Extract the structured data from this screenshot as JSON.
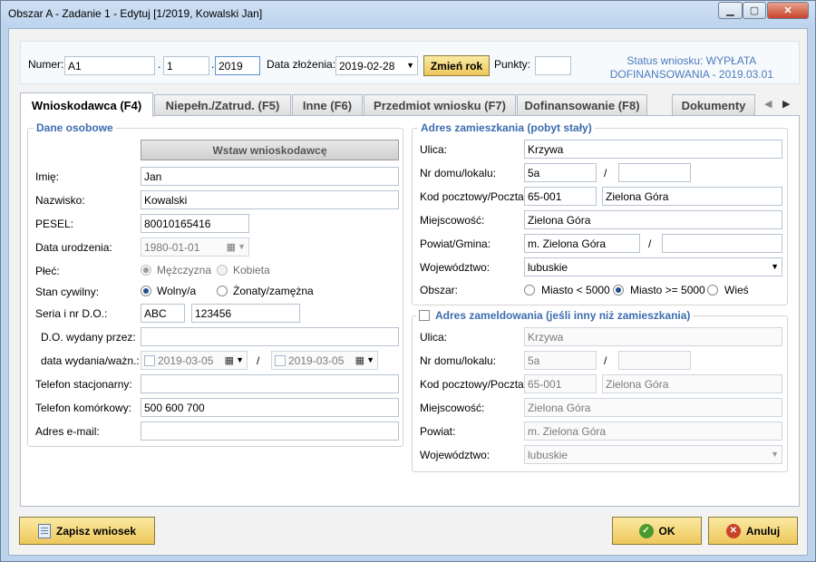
{
  "window": {
    "title": "Obszar A - Zadanie 1 - Edytuj  [1/2019, Kowalski Jan]"
  },
  "header": {
    "numer_label": "Numer:",
    "numer_part1": "A1",
    "numer_part2": "1",
    "numer_part3": "2019",
    "sep1": ".",
    "sep2": ".",
    "data_zlozenia_label": "Data złożenia:",
    "data_zlozenia_value": "2019-02-28",
    "zmien_rok_label": "Zmień rok",
    "punkty_label": "Punkty:",
    "punkty_value": "",
    "status_line1": "Status wniosku: WYPŁATA",
    "status_line2": "DOFINANSOWANIA - 2019.03.01"
  },
  "tabs": [
    {
      "label": "Wnioskodawca (F4)"
    },
    {
      "label": "Niepełn./Zatrud. (F5)"
    },
    {
      "label": "Inne (F6)"
    },
    {
      "label": "Przedmiot wniosku (F7)"
    },
    {
      "label": "Dofinansowanie (F8)"
    },
    {
      "label": "Dokumenty"
    }
  ],
  "dane_osobowe": {
    "title": "Dane osobowe",
    "wstaw_label": "Wstaw wnioskodawcę",
    "imie_label": "Imię:",
    "imie_value": "Jan",
    "nazwisko_label": "Nazwisko:",
    "nazwisko_value": "Kowalski",
    "pesel_label": "PESEL:",
    "pesel_value": "80010165416",
    "data_ur_label": "Data urodzenia:",
    "data_ur_value": "1980-01-01",
    "plec_label": "Płeć:",
    "plec_m": "Mężczyzna",
    "plec_k": "Kobieta",
    "stan_label": "Stan cywilny:",
    "stan_wolny": "Wolny/a",
    "stan_zonaty": "Żonaty/zamężna",
    "seria_label": "Seria i nr D.O.:",
    "seria_value": "ABC",
    "numer_do_value": "123456",
    "wydany_label": "D.O. wydany przez:",
    "wydany_value": "",
    "data_wydania_label": "data wydania/ważn.:",
    "data_wydania_value": "2019-03-05",
    "data_waznosci_value": "2019-03-05",
    "slash": "/",
    "tel_stac_label": "Telefon stacjonarny:",
    "tel_stac_value": "",
    "tel_kom_label": "Telefon komórkowy:",
    "tel_kom_value": "500 600 700",
    "email_label": "Adres e-mail:",
    "email_value": ""
  },
  "adres_zam": {
    "title": "Adres zamieszkania (pobyt stały)",
    "ulica_label": "Ulica:",
    "ulica_value": "Krzywa",
    "nr_label": "Nr domu/lokalu:",
    "nr_domu_value": "5a",
    "nr_lokalu_value": "",
    "slash": "/",
    "kod_label": "Kod pocztowy/Poczta:",
    "kod_value": "65-001",
    "poczta_value": "Zielona Góra",
    "miejsc_label": "Miejscowość:",
    "miejsc_value": "Zielona Góra",
    "powiat_label": "Powiat/Gmina:",
    "powiat_value": "m. Zielona Góra",
    "gmina_value": "",
    "woj_label": "Województwo:",
    "woj_value": "lubuskie",
    "obszar_label": "Obszar:",
    "obszar_1": "Miasto < 5000",
    "obszar_2": "Miasto >= 5000",
    "obszar_3": "Wieś"
  },
  "adres_zamel": {
    "title": "Adres zameldowania (jeśli inny niż zamieszkania)",
    "ulica_label": "Ulica:",
    "ulica_value": "Krzywa",
    "nr_label": "Nr domu/lokalu:",
    "nr_domu_value": "5a",
    "nr_lokalu_value": "",
    "slash": "/",
    "kod_label": "Kod pocztowy/Poczta:",
    "kod_value": "65-001",
    "poczta_value": "Zielona Góra",
    "miejsc_label": "Miejscowość:",
    "miejsc_value": "Zielona Góra",
    "powiat_label": "Powiat:",
    "powiat_value": "m. Zielona Góra",
    "woj_label": "Województwo:",
    "woj_value": "lubuskie"
  },
  "footer": {
    "zapisz_label": "Zapisz wniosek",
    "ok_label": "OK",
    "anuluj_label": "Anuluj"
  },
  "icons": {
    "save": "save-document-icon",
    "ok": "check-circle-icon",
    "cancel": "x-circle-icon"
  },
  "colors": {
    "accent_blue": "#3c6db0",
    "button_gold": "#edc75a",
    "ok_green": "#4a9b2e",
    "cancel_red": "#c9432a"
  }
}
